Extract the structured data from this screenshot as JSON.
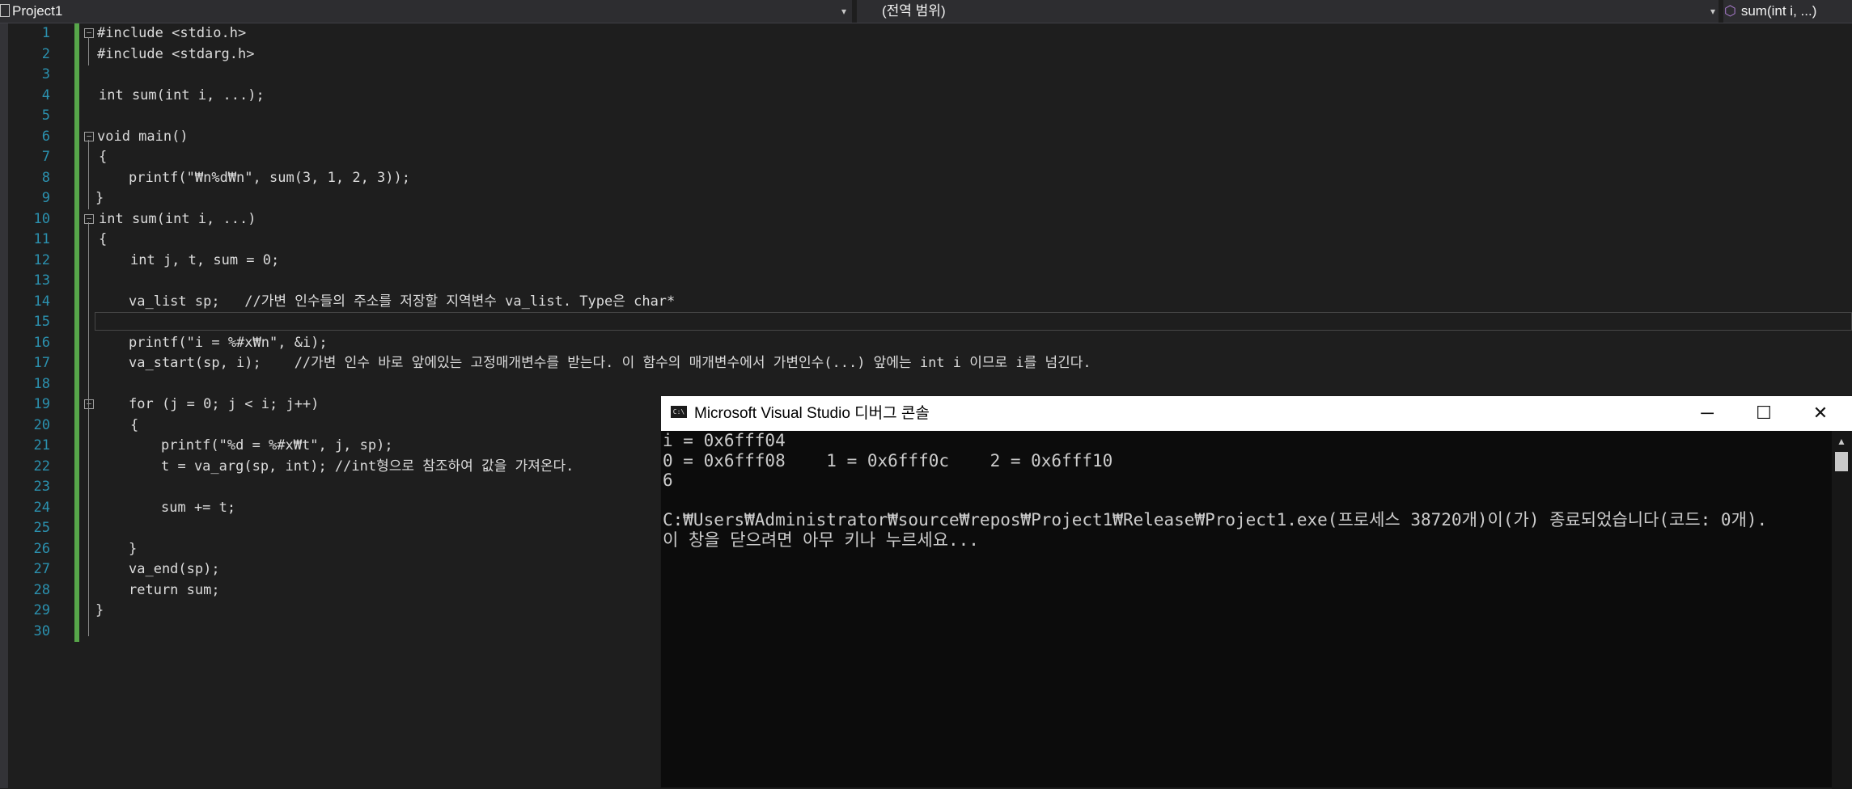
{
  "navbar": {
    "project": "Project1",
    "scope": "(전역 범위)",
    "function": "sum(int i, ...)"
  },
  "editor": {
    "lines": [
      {
        "n": "1",
        "t": "#include <stdio.h>"
      },
      {
        "n": "2",
        "t": "#include <stdarg.h>"
      },
      {
        "n": "3",
        "t": ""
      },
      {
        "n": "4",
        "t": "int sum(int i, ...);"
      },
      {
        "n": "5",
        "t": ""
      },
      {
        "n": "6",
        "t": "void main()"
      },
      {
        "n": "7",
        "t": "{"
      },
      {
        "n": "8",
        "t": "printf(\"₩n%d₩n\", sum(3, 1, 2, 3));"
      },
      {
        "n": "9",
        "t": "}"
      },
      {
        "n": "10",
        "t": "int sum(int i, ...)"
      },
      {
        "n": "11",
        "t": "{"
      },
      {
        "n": "12",
        "t": "int j, t, sum = 0;"
      },
      {
        "n": "13",
        "t": ""
      },
      {
        "n": "14",
        "t": "va_list sp;   //가변 인수들의 주소를 저장할 지역변수 va_list. Type은 char*"
      },
      {
        "n": "15",
        "t": ""
      },
      {
        "n": "16",
        "t": "printf(\"i = %#x₩n\", &i);"
      },
      {
        "n": "17",
        "t": "va_start(sp, i);    //가변 인수 바로 앞에있는 고정매개변수를 받는다. 이 함수의 매개변수에서 가변인수(...) 앞에는 int i 이므로 i를 넘긴다."
      },
      {
        "n": "18",
        "t": ""
      },
      {
        "n": "19",
        "t": "for (j = 0; j < i; j++)"
      },
      {
        "n": "20",
        "t": "{"
      },
      {
        "n": "21",
        "t": "printf(\"%d = %#x₩t\", j, sp);"
      },
      {
        "n": "22",
        "t": "t = va_arg(sp, int); //int형으로 참조하여 값을 가져온다."
      },
      {
        "n": "23",
        "t": ""
      },
      {
        "n": "24",
        "t": "sum += t;"
      },
      {
        "n": "25",
        "t": ""
      },
      {
        "n": "26",
        "t": "}"
      },
      {
        "n": "27",
        "t": "va_end(sp);"
      },
      {
        "n": "28",
        "t": "return sum;"
      },
      {
        "n": "29",
        "t": "}"
      },
      {
        "n": "30",
        "t": ""
      }
    ]
  },
  "console": {
    "title": "Microsoft Visual Studio 디버그 콘솔",
    "icon_label": "C:\\",
    "minimize_icon": "─",
    "maximize_icon": "☐",
    "close_icon": "✕",
    "output": "i = 0x6fff04\n0 = 0x6fff08    1 = 0x6fff0c    2 = 0x6fff10\n6\n\nC:₩Users₩Administrator₩source₩repos₩Project1₩Release₩Project1.exe(프로세스 38720개)이(가) 종료되었습니다(코드: 0개).\n이 창을 닫으려면 아무 키나 누르세요..."
  }
}
